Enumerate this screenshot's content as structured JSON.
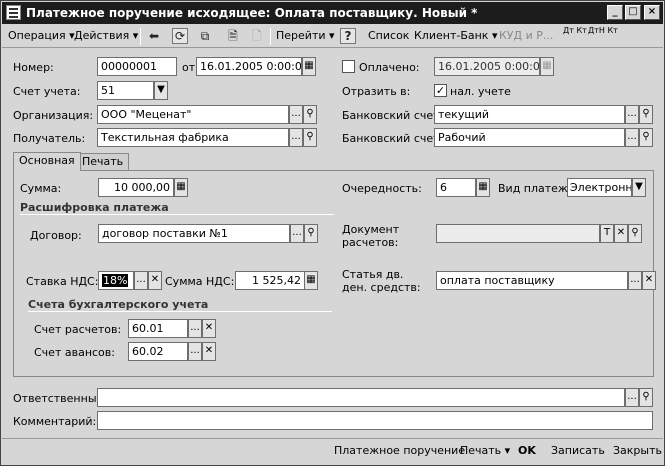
{
  "window": {
    "title": "Платежное поручение исходящее: Оплата поставщику. Новый *"
  },
  "toolbar": {
    "operation": "Операция",
    "actions": "Действия",
    "goto": "Перейти",
    "help": "?",
    "list": "Список",
    "client_bank": "Клиент-Банк",
    "kudir": "КУД и Р...",
    "dt_kt": "Дт Кт",
    "dt_kt_n": "ДтН Кт"
  },
  "header": {
    "number_label": "Номер:",
    "number_value": "00000001",
    "from_label": "от",
    "date_value": "16.01.2005  0:00:00",
    "paid_label": "Оплачено:",
    "paid_date": "16.01.2005  0:00:00",
    "account_label": "Счет учета:",
    "account_value": "51",
    "reflect_label": "Отразить в:",
    "tax_label": "нал. учете",
    "org_label": "Организация:",
    "org_value": "ООО \"Меценат\"",
    "bank_acc_label": "Банковский счет:",
    "bank_acc_value": "текущий",
    "recipient_label": "Получатель:",
    "recipient_value": "Текстильная фабрика",
    "bank_acc2_label": "Банковский счет:",
    "bank_acc2_value": "Рабочий"
  },
  "tabs": {
    "main": "Основная",
    "print": "Печать"
  },
  "main": {
    "sum_label": "Сумма:",
    "sum_value": "10 000,00",
    "order_label": "Очередность:",
    "order_value": "6",
    "pay_type_label": "Вид платежа:",
    "pay_type_value": "Электронно",
    "decoding_title": "Расшифровка платежа",
    "contract_label": "Договор:",
    "contract_value": "договор поставки №1",
    "doc_label_1": "Документ",
    "doc_label_2": "расчетов:",
    "vat_rate_label": "Ставка НДС:",
    "vat_rate_value": "18%",
    "vat_sum_label": "Сумма НДС:",
    "vat_sum_value": "1 525,42",
    "cash_flow_label_1": "Статья дв.",
    "cash_flow_label_2": "ден. средств:",
    "cash_flow_value": "оплата поставщику",
    "accounts_title": "Счета бухгалтерского учета",
    "settle_label": "Счет расчетов:",
    "settle_value": "60.01",
    "advance_label": "Счет авансов:",
    "advance_value": "60.02"
  },
  "bottom": {
    "responsible_label": "Ответственный:",
    "responsible_value": "",
    "comment_label": "Комментарий:",
    "comment_value": ""
  },
  "footer": {
    "payment_order": "Платежное поручение",
    "print": "Печать",
    "ok": "OK",
    "save": "Записать",
    "close": "Закрыть"
  },
  "icons": {
    "dots": "...",
    "search": "🔍",
    "clear": "✕",
    "calendar": "▦",
    "dropdown": "▼",
    "check": "✓"
  }
}
